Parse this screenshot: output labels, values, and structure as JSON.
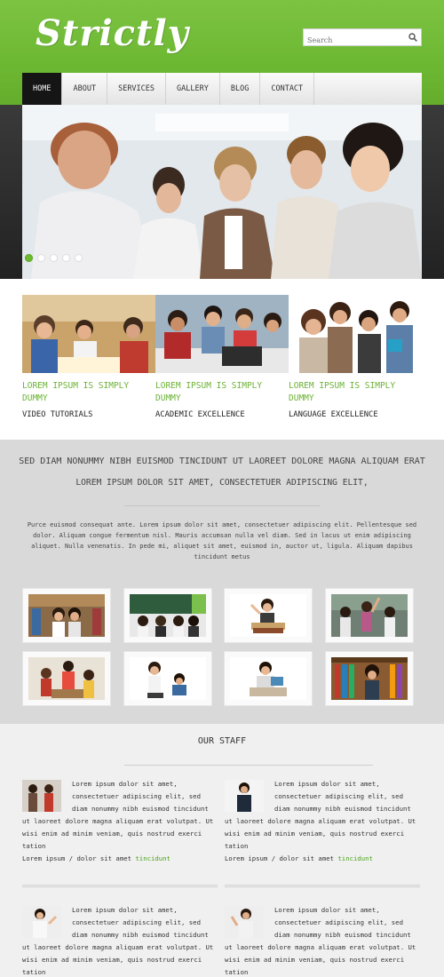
{
  "header": {
    "logo": "Strictly",
    "search_placeholder": "Search",
    "brand_color": "#6db833"
  },
  "nav": {
    "items": [
      {
        "label": "HOME",
        "active": true
      },
      {
        "label": "ABOUT"
      },
      {
        "label": "SERVICES"
      },
      {
        "label": "GALLERY"
      },
      {
        "label": "BLOG"
      },
      {
        "label": "CONTACT"
      }
    ]
  },
  "slider": {
    "dots": 5,
    "active_index": 0
  },
  "features": [
    {
      "title": "LOREM IPSUM IS SIMPLY DUMMY",
      "subtitle": "VIDEO TUTORIALS"
    },
    {
      "title": "LOREM IPSUM IS SIMPLY DUMMY",
      "subtitle": "ACADEMIC EXCELLENCE"
    },
    {
      "title": "LOREM IPSUM IS SIMPLY DUMMY",
      "subtitle": "LANGUAGE EXCELLENCE"
    }
  ],
  "intro": {
    "headline": "SED DIAM NONUMMY NIBH EUISMOD TINCIDUNT UT LAOREET DOLORE MAGNA ALIQUAM ERAT",
    "subheadline": "LOREM IPSUM DOLOR SIT AMET, CONSECTETUER ADIPISCING ELIT,",
    "paragraph": "Purce euismod consequat ante. Lorem ipsum dolor sit amet, consectetuer adipiscing elit. Pellentesque sed dolor. Aliquam congue fermentum nisl. Mauris accumsan nulla vel diam. Sed in lacus ut enim adipiscing aliquet. Nulla venenatis. In pede mi, aliquet sit amet, euismod in, auctor ut, ligula. Aliquam dapibus tincidunt metus"
  },
  "staff": {
    "title": "OUR STAFF",
    "members": [
      {
        "intro": "Lorem ipsum dolor sit amet, consectetuer adipiscing elit, sed diam nonummy nibh euismod tincidunt",
        "body": "ut laoreet dolore magna aliquam erat volutpat. Ut wisi enim ad minim veniam, quis nostrud exerci tation",
        "meta": "Lorem ipsum / dolor sit amet ",
        "link": "tincidunt"
      },
      {
        "intro": "Lorem ipsum dolor sit amet, consectetuer adipiscing elit, sed diam nonummy nibh euismod tincidunt",
        "body": "ut laoreet dolore magna aliquam erat volutpat. Ut wisi enim ad minim veniam, quis nostrud exerci tation",
        "meta": "Lorem ipsum / dolor sit amet ",
        "link": "tincidunt"
      },
      {
        "intro": "Lorem ipsum dolor sit amet, consectetuer adipiscing elit, sed diam nonummy nibh euismod tincidunt",
        "body": "ut laoreet dolore magna aliquam erat volutpat. Ut wisi enim ad minim veniam, quis nostrud exerci tation"
      },
      {
        "intro": "Lorem ipsum dolor sit amet, consectetuer adipiscing elit, sed diam nonummy nibh euismod tincidunt",
        "body": "ut laoreet dolore magna aliquam erat volutpat. Ut wisi enim ad minim veniam, quis nostrud exerci tation"
      }
    ]
  }
}
